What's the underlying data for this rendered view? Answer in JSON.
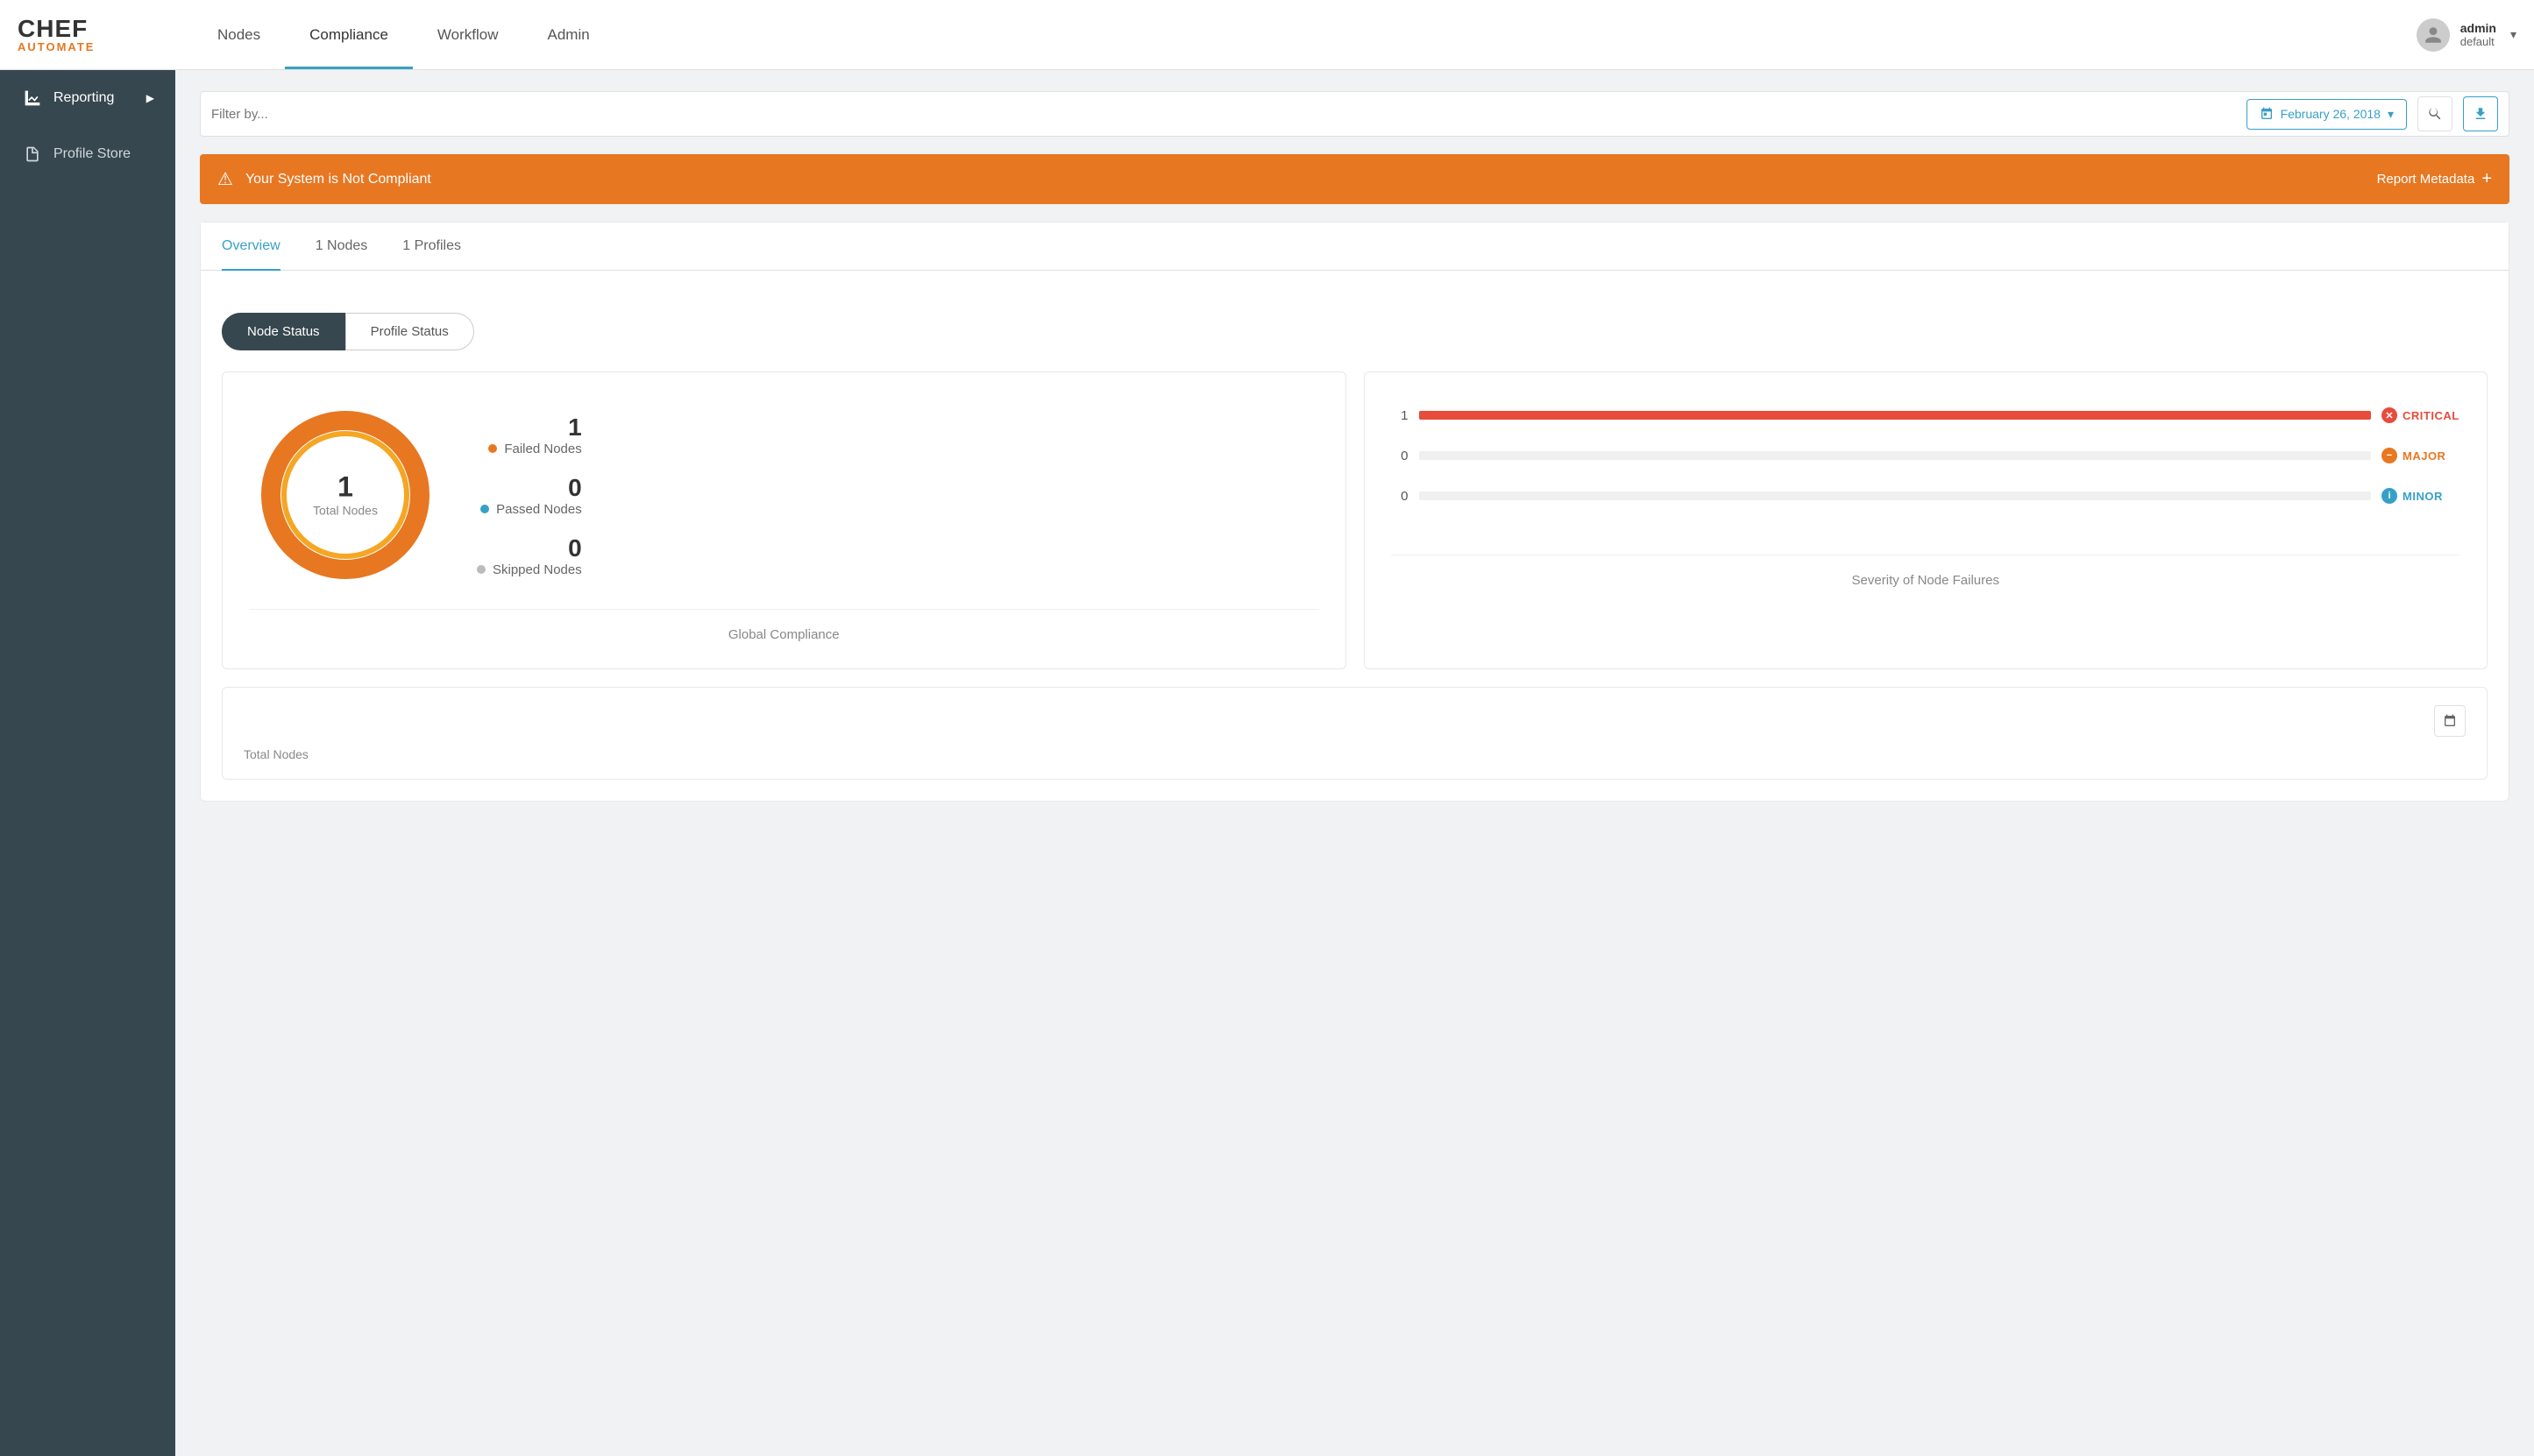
{
  "app": {
    "logo_chef": "CHEF",
    "logo_automate": "AUTOMATE"
  },
  "nav": {
    "links": [
      {
        "id": "nodes",
        "label": "Nodes",
        "active": false
      },
      {
        "id": "compliance",
        "label": "Compliance",
        "active": true
      },
      {
        "id": "workflow",
        "label": "Workflow",
        "active": false
      },
      {
        "id": "admin",
        "label": "Admin",
        "active": false
      }
    ]
  },
  "user": {
    "name": "admin",
    "role": "default"
  },
  "sidebar": {
    "items": [
      {
        "id": "reporting",
        "label": "Reporting",
        "icon": "chart-icon",
        "has_arrow": true
      },
      {
        "id": "profile-store",
        "label": "Profile Store",
        "icon": "document-icon",
        "has_arrow": false
      }
    ]
  },
  "filter": {
    "placeholder": "Filter by...",
    "date": "February 26, 2018"
  },
  "banner": {
    "message": "Your System is Not Compliant",
    "action": "Report Metadata"
  },
  "tabs": [
    {
      "id": "overview",
      "label": "Overview",
      "active": true
    },
    {
      "id": "nodes",
      "label": "1 Nodes",
      "active": false
    },
    {
      "id": "profiles",
      "label": "1 Profiles",
      "active": false
    }
  ],
  "toggle": {
    "node_status": "Node Status",
    "profile_status": "Profile Status"
  },
  "donut": {
    "total": "1",
    "total_label": "Total Nodes",
    "failed": {
      "count": "1",
      "label": "Failed Nodes"
    },
    "passed": {
      "count": "0",
      "label": "Passed Nodes"
    },
    "skipped": {
      "count": "0",
      "label": "Skipped Nodes"
    },
    "footer": "Global Compliance"
  },
  "severity": {
    "title": "Severity of Node Failures",
    "items": [
      {
        "id": "critical",
        "label": "CRITICAL",
        "count": "1",
        "value": 100,
        "icon_text": "✕"
      },
      {
        "id": "major",
        "label": "MAJOR",
        "count": "0",
        "value": 0,
        "icon_text": "−"
      },
      {
        "id": "minor",
        "label": "MINOR",
        "count": "0",
        "value": 0,
        "icon_text": "ℹ"
      }
    ]
  },
  "bottom_card": {
    "total_nodes_label": "Total Nodes"
  },
  "colors": {
    "accent": "#37a0c7",
    "sidebar_bg": "#37474f",
    "orange": "#e87722",
    "critical": "#e74c3c"
  }
}
